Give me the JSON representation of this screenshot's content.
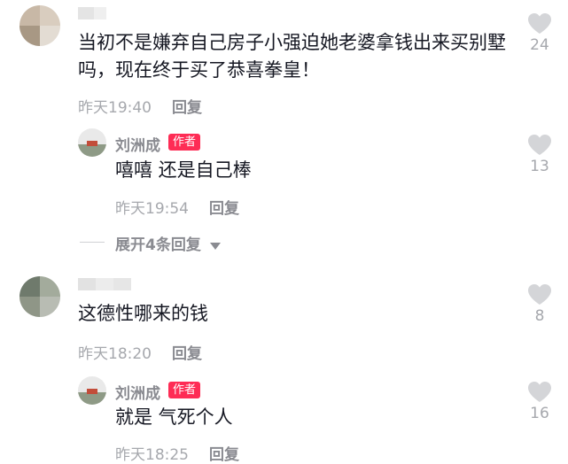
{
  "comments": [
    {
      "text_line1": "当初不是嫌弃自己房子小强迫她老婆拿钱出来买别墅",
      "text_line2": "吗，现在终于买了恭喜拳皇！",
      "time": "昨天19:40",
      "reply_label": "回复",
      "likes": "24",
      "reply": {
        "author": "刘洲成",
        "badge": "作者",
        "text": "嘻嘻 还是自己棒",
        "time": "昨天19:54",
        "reply_label": "回复",
        "likes": "13"
      },
      "expand_label": "展开4条回复"
    },
    {
      "text_line1": "这德性哪来的钱",
      "time": "昨天18:20",
      "reply_label": "回复",
      "likes": "8",
      "reply": {
        "author": "刘洲成",
        "badge": "作者",
        "text": "就是 气死个人",
        "time": "昨天18:25",
        "reply_label": "回复",
        "likes": "16"
      }
    }
  ],
  "colors": {
    "accent": "#fe2c55",
    "meta": "#a6a8ad",
    "text": "#161823"
  },
  "icons": {
    "like": "heart-icon",
    "expand": "chevron-down-icon"
  }
}
